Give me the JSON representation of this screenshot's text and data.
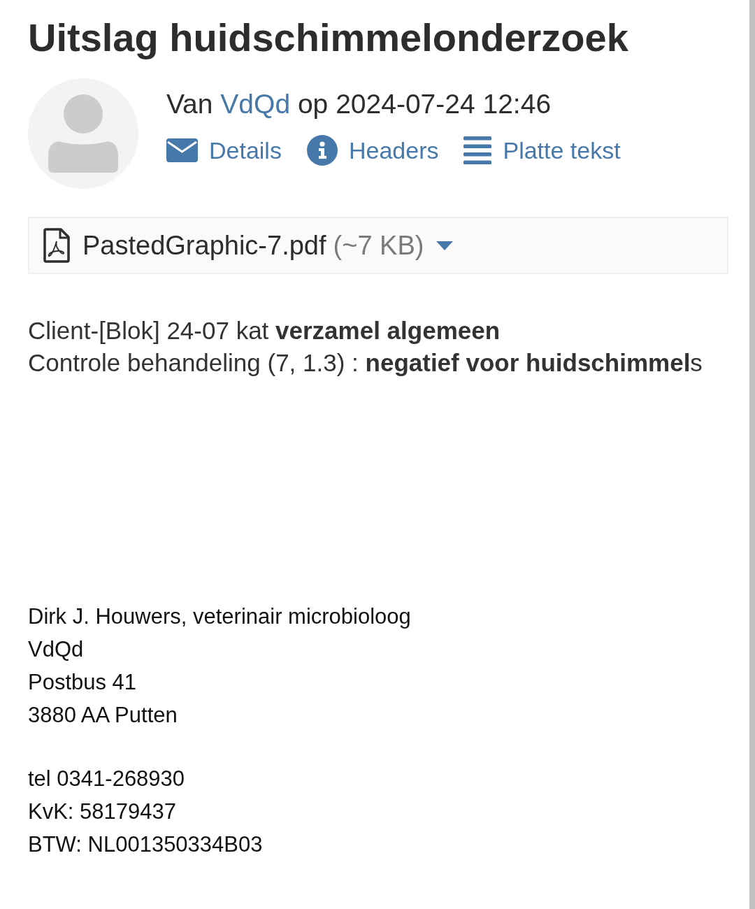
{
  "header": {
    "title": "Uitslag huidschimmelonderzoek"
  },
  "meta": {
    "prefix": "Van",
    "sender": "VdQd",
    "date_prefix": "op",
    "date": "2024-07-24 12:46"
  },
  "actions": [
    {
      "kind": "details",
      "label": "Details"
    },
    {
      "kind": "headers",
      "label": "Headers"
    },
    {
      "kind": "plain",
      "label": "Platte tekst"
    }
  ],
  "attachment": {
    "filename": "PastedGraphic-7.pdf",
    "size": "(~7 KB)"
  },
  "body": {
    "lines": [
      "Client-[Blok] 24-07 kat **verzamel algemeen**",
      "Controle behandeling (7, 1.3) : **negatief voor huidschimmel**s"
    ]
  },
  "signature": {
    "blocks": [
      [
        "Dirk J. Houwers, veterinair microbioloog",
        "VdQd",
        "Postbus 41",
        "3880 AA Putten"
      ],
      [
        "tel 0341-268930",
        "KvK: 58179437",
        "BTW: NL001350334B03"
      ]
    ]
  }
}
